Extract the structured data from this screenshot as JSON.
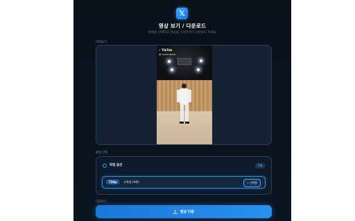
{
  "header": {
    "logo_glyph": "𝕏",
    "title": "영상 보기 / 다운로드",
    "subtitle": "화질을 선택하고 영상을 구경하거나 다운로드 하세요"
  },
  "preview": {
    "label": "미리보기",
    "tiktok_badge": "♪ TikTok",
    "tiktok_user": "@ username"
  },
  "quality": {
    "label": "화질 선택",
    "auto_label": "화질 옵션",
    "option_count": "1개",
    "options": [
      {
        "resolution": "720p",
        "label": "고화질 (HD)",
        "selected_text": "✓ 선택됨"
      }
    ]
  },
  "download": {
    "label": "다운로드",
    "button_label": "영상 다운"
  },
  "colors": {
    "accent": "#2a8ff0",
    "panel_bg": "#0b1119",
    "border": "#27415c"
  }
}
